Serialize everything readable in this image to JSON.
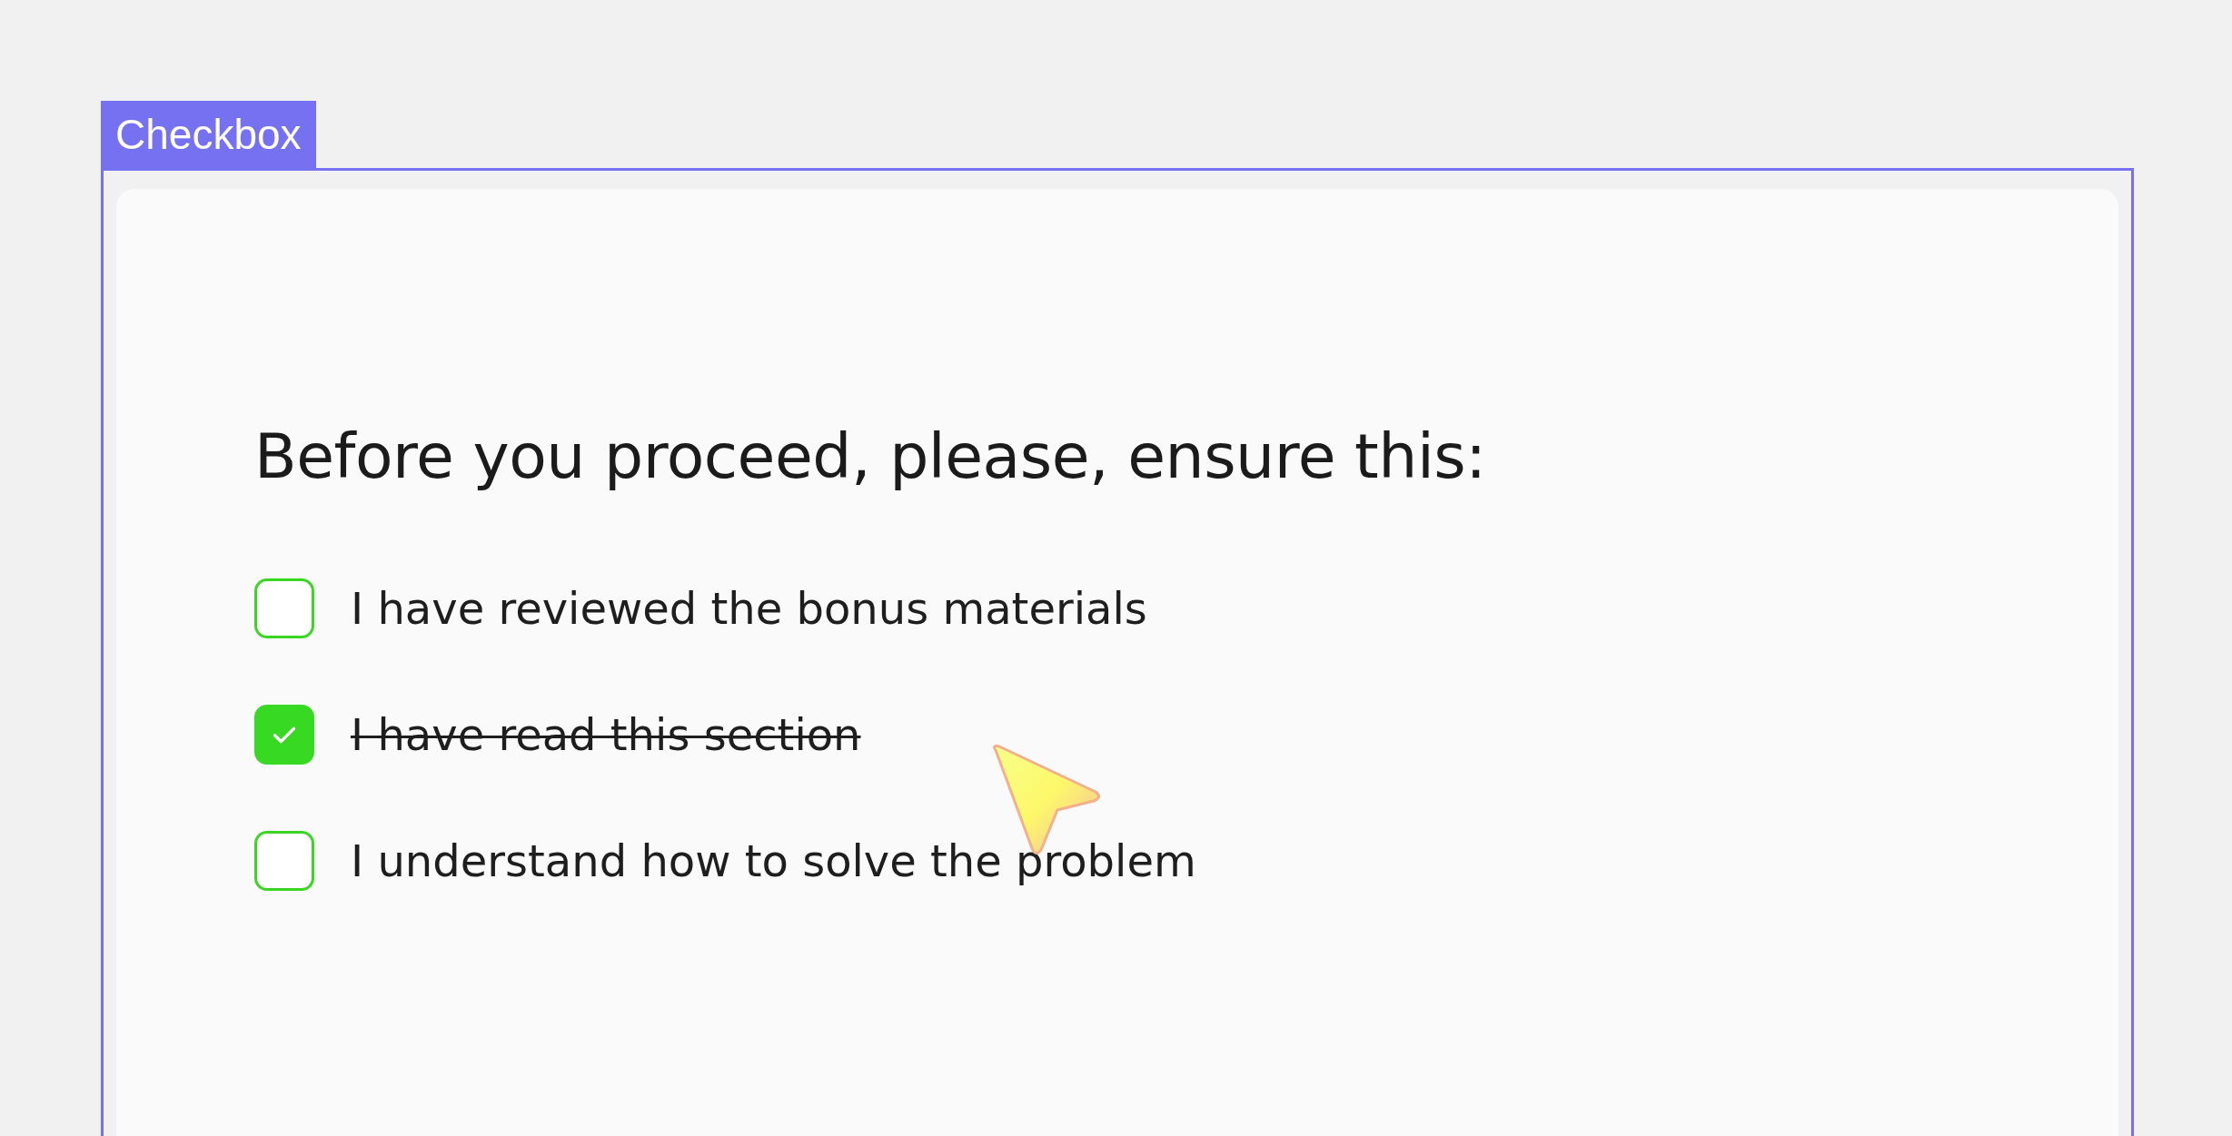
{
  "frame_label": "Checkbox",
  "heading": "Before you proceed, please, ensure this:",
  "items": [
    {
      "label": "I have reviewed the bonus materials",
      "checked": false
    },
    {
      "label": "I have read this section",
      "checked": true
    },
    {
      "label": "I understand how to solve the problem",
      "checked": false
    }
  ]
}
